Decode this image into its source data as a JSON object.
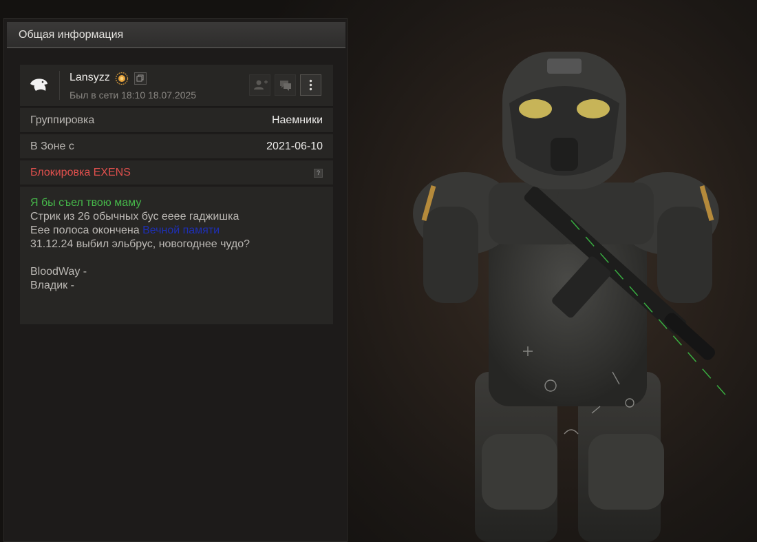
{
  "panel": {
    "title": "Общая информация"
  },
  "profile": {
    "username": "Lansyzz",
    "last_seen": "Был в сети 18:10 18.07.2025",
    "icons": [
      "eagle-logo-icon",
      "sun-badge-icon",
      "copy-icon",
      "add-friend-icon",
      "message-icon",
      "more-icon"
    ]
  },
  "rows": {
    "faction_label": "Группировка",
    "faction_value": "Наемники",
    "zone_label": "В Зоне с",
    "zone_value": "2021-06-10",
    "block_label": "Блокировка EXENS",
    "help_label": "?"
  },
  "bio": {
    "line1": "Я бы съел твою маму",
    "line2": "Стрик из 26 обычных бус ееее гаджишка",
    "line3_prefix": "Еее полоса окончена",
    "line3_link": "Вечной памяти",
    "line4": "31.12.24 выбил эльбрус, новогоднее чудо?",
    "line5": "BloodWay -",
    "line6": "Владик -"
  },
  "colors": {
    "accent_red": "#e0504d",
    "bio_green": "#46b84a",
    "bio_link": "#1e2fb4",
    "panel_bg": "#1d1b1a",
    "card_bg": "#272624"
  }
}
